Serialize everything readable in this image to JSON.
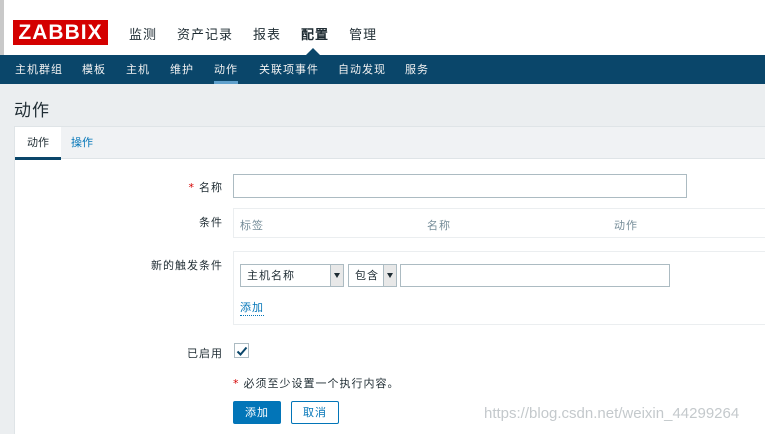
{
  "brand": {
    "logo": "ZABBIX"
  },
  "main_menu": [
    "监测",
    "资产记录",
    "报表",
    "配置",
    "管理"
  ],
  "sub_menu": [
    "主机群组",
    "模板",
    "主机",
    "维护",
    "动作",
    "关联项事件",
    "自动发现",
    "服务"
  ],
  "page": {
    "title": "动作"
  },
  "tabs": [
    "动作",
    "操作"
  ],
  "form": {
    "name_label": "名称",
    "required_mark": "*",
    "name_value": "",
    "conditions_label": "条件",
    "conditions_headers": [
      "标签",
      "名称",
      "动作"
    ],
    "new_condition_label": "新的触发条件",
    "condition_type": "主机名称",
    "condition_operator": "包含",
    "condition_value": "",
    "add_link": "添加",
    "enabled_label": "已启用",
    "enabled": true,
    "note": "必须至少设置一个执行内容。",
    "add_button": "添加",
    "cancel_button": "取消"
  },
  "watermark": "https://blog.csdn.net/weixin_44299264",
  "colors": {
    "accent": "#0a466a",
    "link": "#0275b8",
    "brand_red": "#d40000"
  }
}
